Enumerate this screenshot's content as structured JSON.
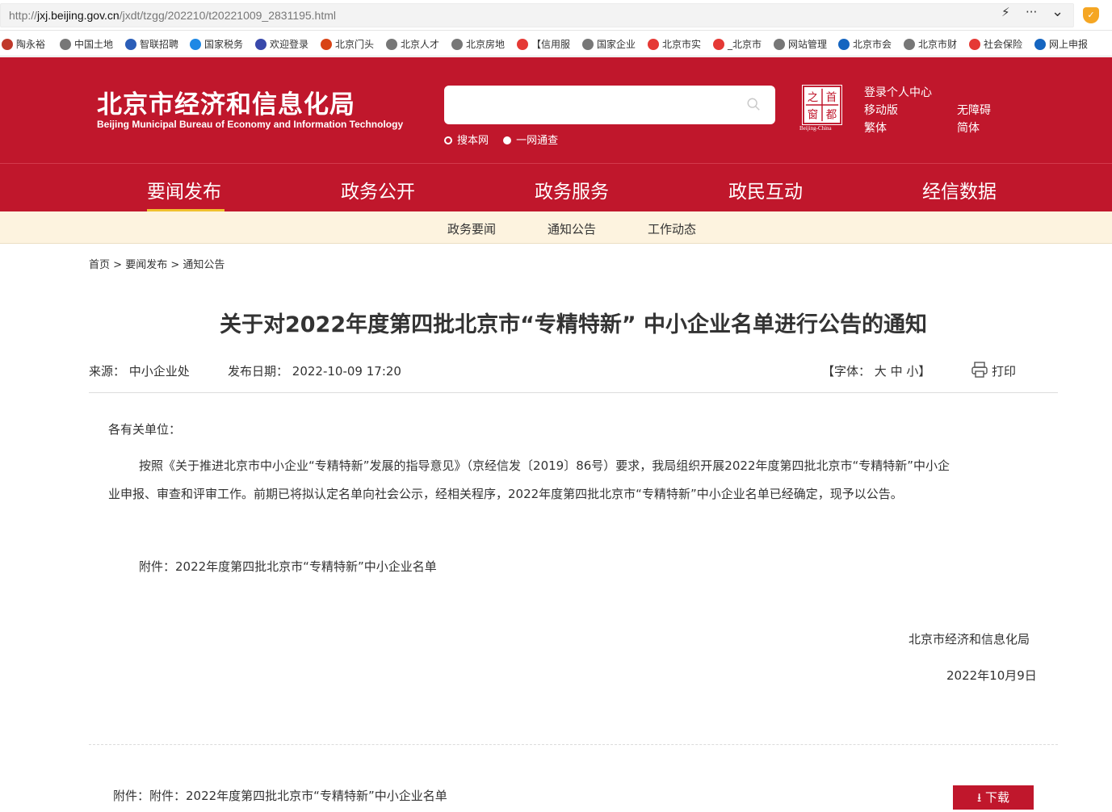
{
  "browser": {
    "url_prefix": "http://",
    "url_host": "jxj.beijing.gov.cn",
    "url_path": "/jxdt/tzgg/202210/t20221009_2831195.html",
    "actions": [
      "⚡",
      "···",
      "⌄"
    ],
    "bookmarks": [
      {
        "label": "陶永裕",
        "color": "#c0392b"
      },
      {
        "label": "中国土地",
        "color": "#777777"
      },
      {
        "label": "智联招聘",
        "color": "#2b5eb8"
      },
      {
        "label": "国家税务",
        "color": "#1e88e5"
      },
      {
        "label": "欢迎登录",
        "color": "#3949ab"
      },
      {
        "label": "北京门头",
        "color": "#d84315"
      },
      {
        "label": "北京人才",
        "color": "#777777"
      },
      {
        "label": "北京房地",
        "color": "#777777"
      },
      {
        "label": "【信用服",
        "color": "#e53935"
      },
      {
        "label": "国家企业",
        "color": "#777777"
      },
      {
        "label": "北京市实",
        "color": "#e53935"
      },
      {
        "label": "_北京市",
        "color": "#e53935"
      },
      {
        "label": "网站管理",
        "color": "#777777"
      },
      {
        "label": "北京市会",
        "color": "#1565c0"
      },
      {
        "label": "北京市财",
        "color": "#777777"
      },
      {
        "label": "社会保险",
        "color": "#e53935"
      },
      {
        "label": "网上申报",
        "color": "#1565c0"
      }
    ]
  },
  "header": {
    "title": "北京市经济和信息化局",
    "subtitle": "Beijing Municipal Bureau of Economy and Information Technology",
    "search_placeholder": "",
    "radio_this_site": "搜本网",
    "radio_all": "一网通查",
    "seal_chars": [
      "之",
      "首",
      "窗",
      "都"
    ],
    "seal_caption": "Beijing-China",
    "links": {
      "login": "登录个人中心",
      "mobile": "移动版",
      "accessible": "无障碍",
      "traditional": "繁体",
      "simplified": "简体"
    }
  },
  "nav": {
    "items": [
      "要闻发布",
      "政务公开",
      "政务服务",
      "政民互动",
      "经信数据"
    ],
    "sub_items": [
      "政务要闻",
      "通知公告",
      "工作动态"
    ]
  },
  "breadcrumb": {
    "home": "首页",
    "sep": ">",
    "level1": "要闻发布",
    "level2": "通知公告"
  },
  "article": {
    "title": "关于对2022年度第四批北京市“专精特新” 中小企业名单进行公告的通知",
    "source_label": "来源：",
    "source": "中小企业处",
    "date_label": "发布日期：",
    "date": "2022-10-09 17:20",
    "font_size_label": "【字体：",
    "font_large": "大",
    "font_medium": "中",
    "font_small": "小】",
    "print": "打印",
    "salutation": "各有关单位：",
    "body_line1": "按照《关于推进北京市中小企业“专精特新”发展的指导意见》（京经信发〔2019〕86号）要求，我局组织开展2022年度第四批北京市“专精特新”中小企",
    "body_line2": "业申报、审查和评审工作。前期已将拟认定名单向社会公示，经相关程序，2022年度第四批北京市“专精特新”中小企业名单已经确定，现予以公告。",
    "attachment_line": "附件：2022年度第四批北京市“专精特新”中小企业名单",
    "signature": "北京市经济和信息化局",
    "sign_date": "2022年10月9日",
    "footer_attachment": "附件：附件：2022年度第四批北京市“专精特新”中小企业名单",
    "download": "下载"
  },
  "colors": {
    "brand_red": "#c0172c",
    "subnav_bg": "#fdf3df",
    "active_underline": "#f0c12e"
  }
}
